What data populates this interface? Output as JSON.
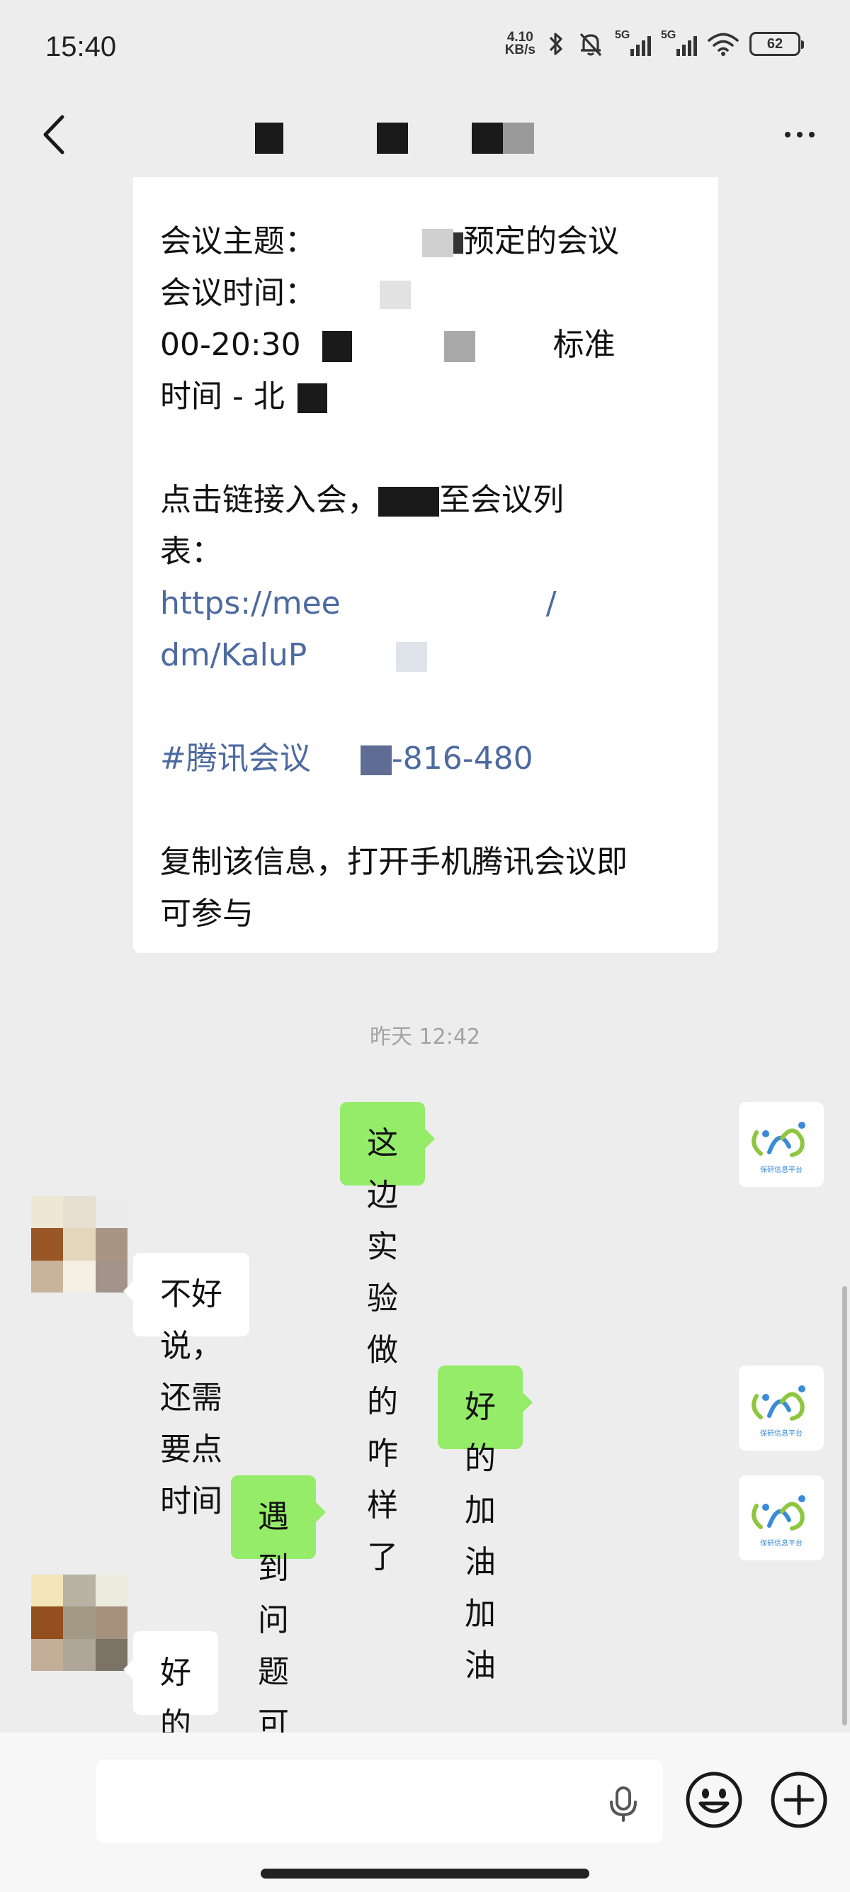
{
  "status_bar": {
    "time": "15:40",
    "net_speed_value": "4.10",
    "net_speed_unit": "KB/s",
    "signal_1_label": "5G",
    "signal_2_label": "5G",
    "battery": "62"
  },
  "chat": {
    "title": "",
    "meeting_card": {
      "lines_top": [
        "会议主题：",
        "会议时间：",
        "00-20:30",
        "时间 - 北"
      ],
      "topic_suffix": "预定的会议",
      "time_suffix": "标准",
      "join_text": "点击链接入会，",
      "join_suffix": "至会议列",
      "join_line2": "表：",
      "link_line1": "https://mee",
      "link_line1_tail": "/",
      "link_line2": "dm/KaluP",
      "meeting_tag": "#腾讯会议",
      "meeting_number": "-816-480",
      "footer_line1": "复制该信息，打开手机腾讯会议即",
      "footer_line2": "可参与"
    },
    "time_separator": "昨天 12:42",
    "messages": [
      {
        "side": "right",
        "text": "这边实验做的咋样了"
      },
      {
        "side": "left",
        "text": "不好说，还需要点时间"
      },
      {
        "side": "right",
        "text": "好的 加油加油"
      },
      {
        "side": "right",
        "text": "遇到问题可以及时反馈一下"
      },
      {
        "side": "left",
        "text": "好的"
      }
    ],
    "self_avatar_caption": "保研信息平台"
  },
  "input_bar": {
    "value": "",
    "placeholder": ""
  },
  "icons": {
    "back": "back-arrow-icon",
    "more": "more-icon",
    "mic": "microphone-icon",
    "emoji": "emoji-icon",
    "plus": "plus-icon",
    "bluetooth": "bluetooth-icon",
    "mute": "bell-off-icon",
    "wifi": "wifi-icon"
  },
  "colors": {
    "background": "#ededed",
    "bubble_self": "#95ec69",
    "bubble_other": "#ffffff",
    "link": "#4d6aa0"
  }
}
